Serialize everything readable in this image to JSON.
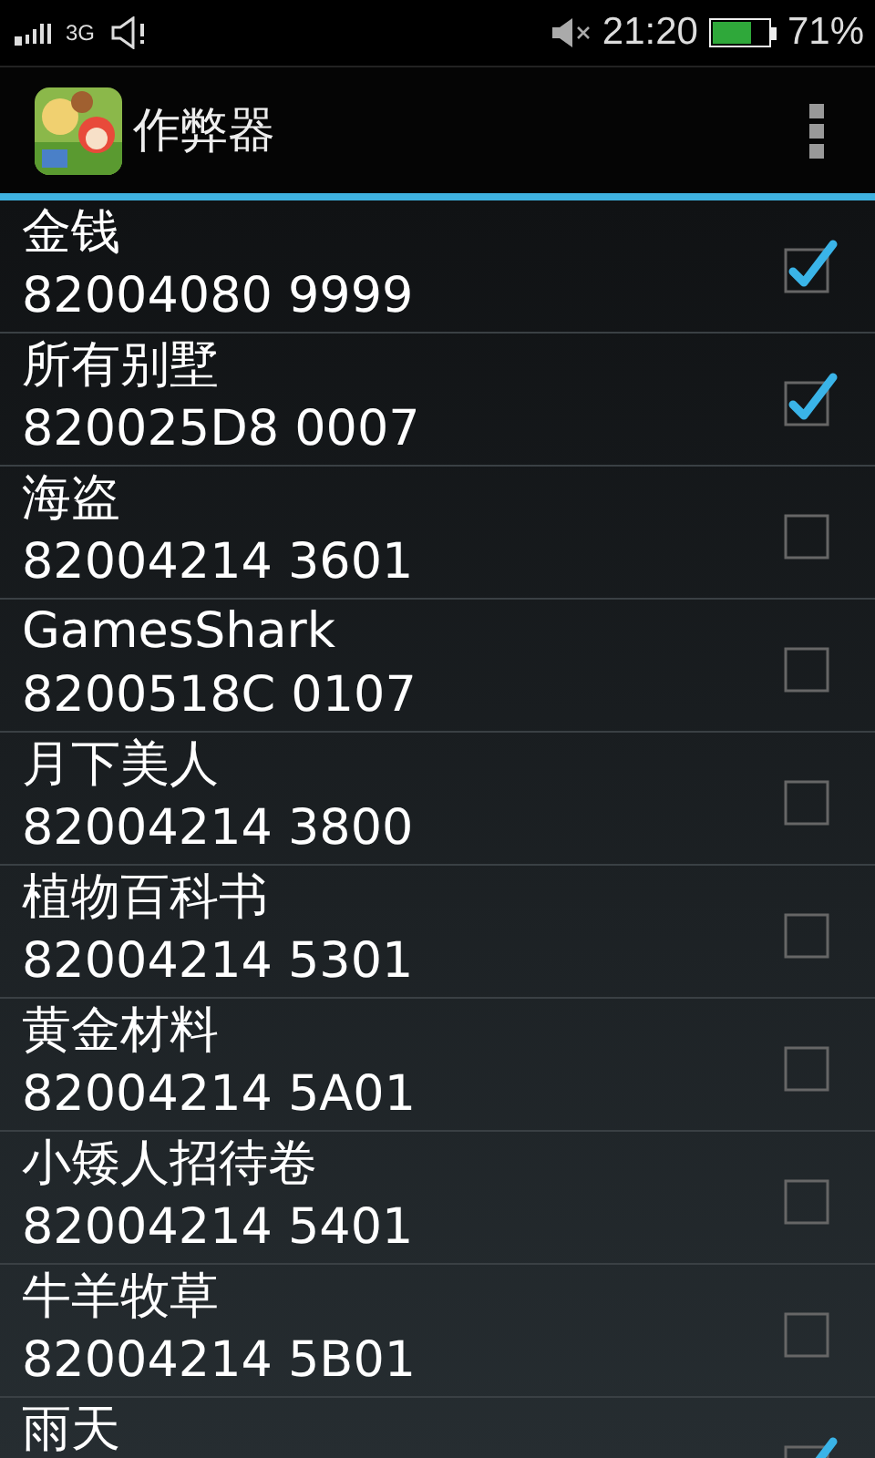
{
  "status_bar": {
    "network": "3G",
    "time": "21:20",
    "battery": "71%"
  },
  "action_bar": {
    "title": "作弊器"
  },
  "cheats": [
    {
      "name": "金钱",
      "code": "82004080 9999",
      "checked": true
    },
    {
      "name": "所有别墅",
      "code": "820025D8 0007",
      "checked": true
    },
    {
      "name": "海盗",
      "code": "82004214 3601",
      "checked": false
    },
    {
      "name": "GamesShark",
      "code": "8200518C 0107",
      "checked": false
    },
    {
      "name": "月下美人",
      "code": "82004214 3800",
      "checked": false
    },
    {
      "name": "植物百科书",
      "code": "82004214 5301",
      "checked": false
    },
    {
      "name": "黄金材料",
      "code": "82004214 5A01",
      "checked": false
    },
    {
      "name": "小矮人招待卷",
      "code": "82004214 5401",
      "checked": false
    },
    {
      "name": "牛羊牧草",
      "code": "82004214 5B01",
      "checked": false
    },
    {
      "name": "雨天",
      "checked": true
    }
  ]
}
